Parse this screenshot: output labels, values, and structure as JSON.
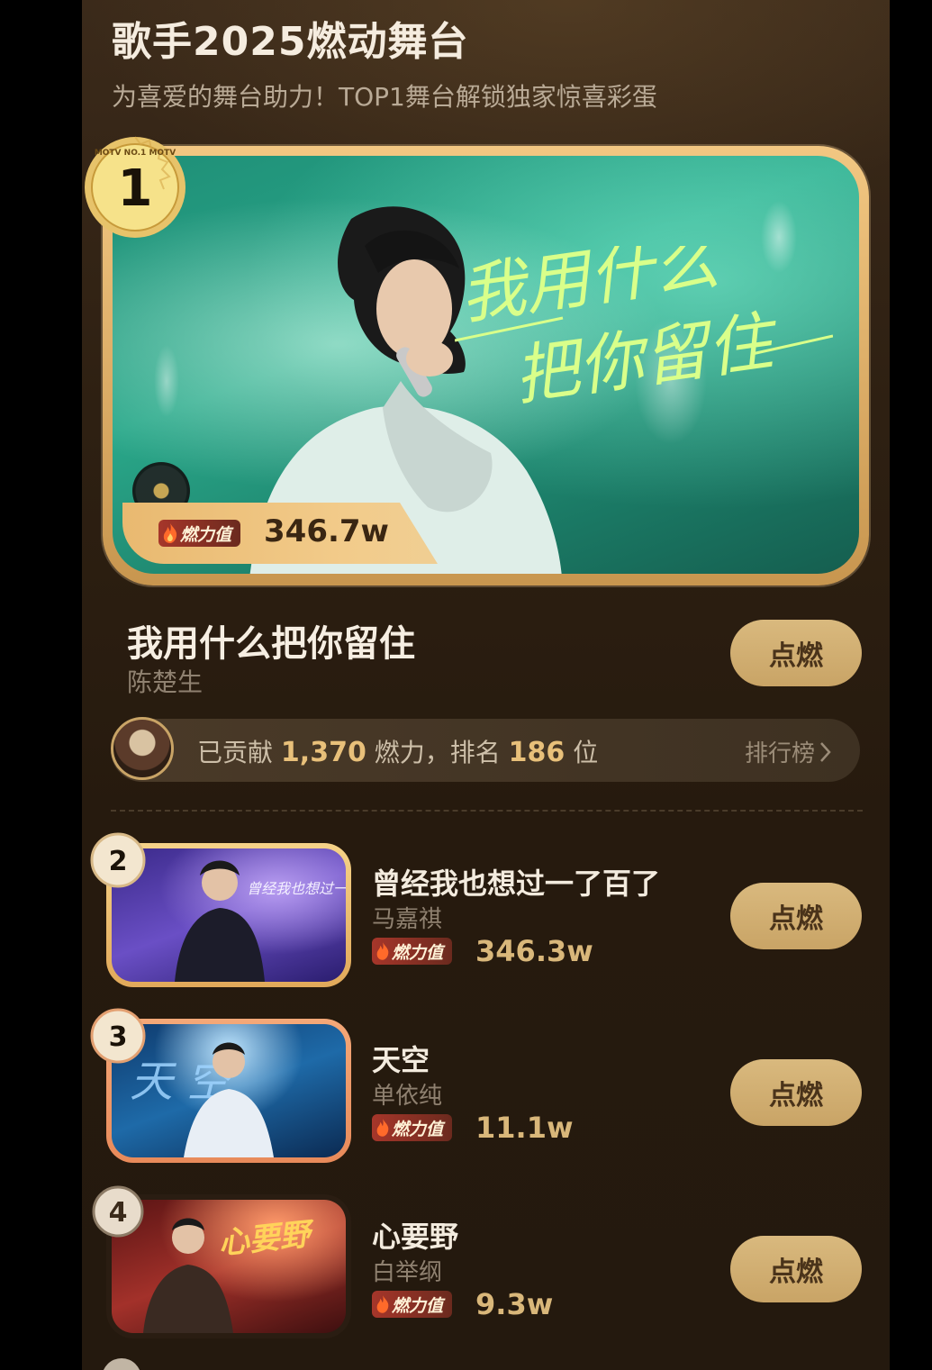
{
  "header": {
    "title": "歌手2025燃动舞台",
    "subtitle": "为喜爱的舞台助力！TOP1舞台解锁独家惊喜彩蛋"
  },
  "top": {
    "rank": "1",
    "badge_text": "MOTV NO.1 MOTV",
    "cover_text_line1": "我用什么",
    "cover_text_line2": "把你留住",
    "fire_label": "燃力值",
    "fire_value": "346.7w",
    "song": "我用什么把你留住",
    "singer": "陈楚生",
    "button_label": "点燃"
  },
  "contribution": {
    "prefix": "已贡献",
    "amount": "1,370",
    "middle": "燃力，排名",
    "rank": "186",
    "suffix": "位",
    "link_label": "排行榜"
  },
  "list": [
    {
      "rank": "2",
      "song": "曾经我也想过一了百了",
      "singer": "马嘉祺",
      "fire_label": "燃力值",
      "fire_value": "346.3w",
      "button_label": "点燃",
      "cover_text": "曾经我也想过一了百了"
    },
    {
      "rank": "3",
      "song": "天空",
      "singer": "单依纯",
      "fire_label": "燃力值",
      "fire_value": "11.1w",
      "button_label": "点燃",
      "cover_text": "天 空"
    },
    {
      "rank": "4",
      "song": "心要野",
      "singer": "白举纲",
      "fire_label": "燃力值",
      "fire_value": "9.3w",
      "button_label": "点燃",
      "cover_text": "心要野"
    }
  ],
  "colors": {
    "accent_gold": "#c9a466",
    "fire_red": "#a6362a",
    "rank2_border": "#f0c777",
    "rank3_border": "#f19a6c",
    "rank4_border": "#3b2a1a"
  }
}
